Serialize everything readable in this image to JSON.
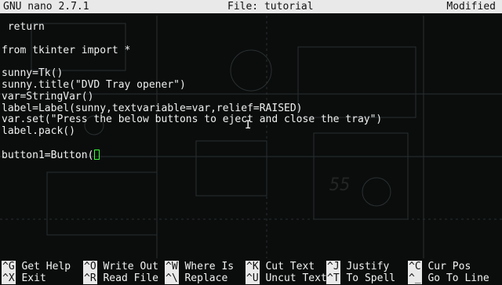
{
  "titlebar": {
    "app": "GNU nano 2.7.1",
    "file": "File: tutorial",
    "status": "Modified"
  },
  "editor": {
    "lines": [
      " return",
      "",
      "from tkinter import *",
      "",
      "sunny=Tk()",
      "sunny.title(\"DVD Tray opener\")",
      "var=StringVar()",
      "label=Label(sunny,textvariable=var,relief=RAISED)",
      "var.set(\"Press the below buttons to eject and close the tray\")",
      "label.pack()",
      "",
      "button1=Button("
    ]
  },
  "shortcuts": {
    "row1": [
      {
        "key": "^G",
        "label": "Get Help"
      },
      {
        "key": "^O",
        "label": "Write Out"
      },
      {
        "key": "^W",
        "label": "Where Is"
      },
      {
        "key": "^K",
        "label": "Cut Text"
      },
      {
        "key": "^J",
        "label": "Justify"
      },
      {
        "key": "^C",
        "label": "Cur Pos"
      }
    ],
    "row2": [
      {
        "key": "^X",
        "label": "Exit"
      },
      {
        "key": "^R",
        "label": "Read File"
      },
      {
        "key": "^\\",
        "label": "Replace"
      },
      {
        "key": "^U",
        "label": "Uncut Text"
      },
      {
        "key": "^T",
        "label": "To Spell"
      },
      {
        "key": "^_",
        "label": "Go To Line"
      }
    ]
  }
}
